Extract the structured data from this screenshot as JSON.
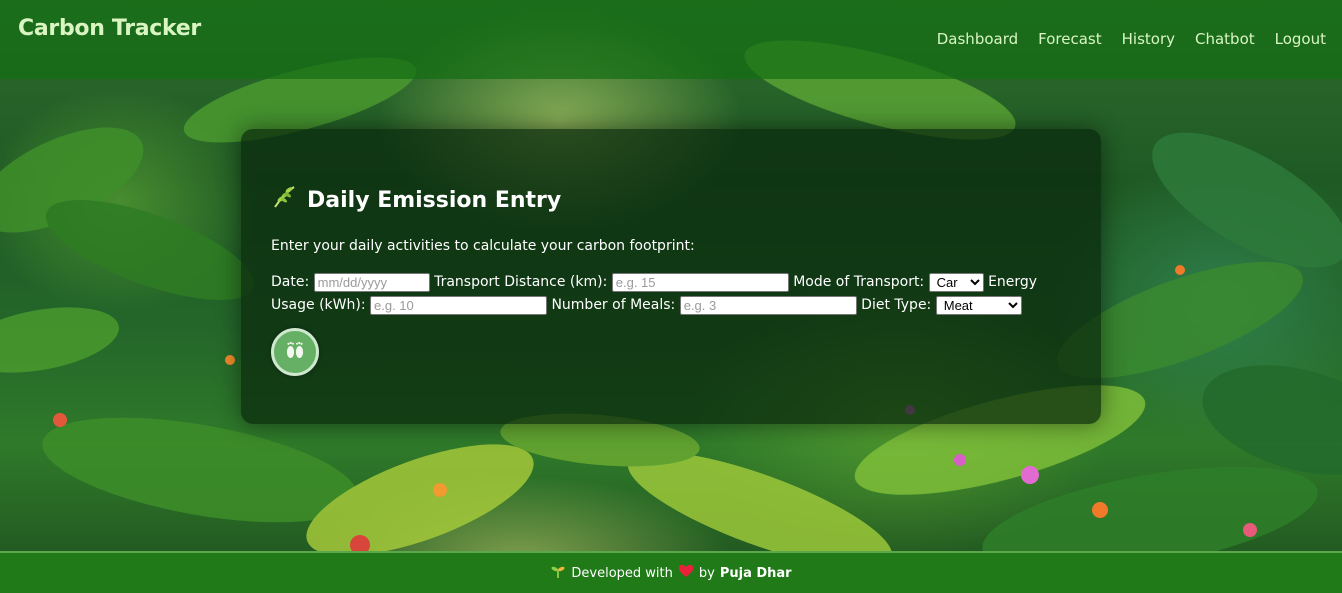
{
  "header": {
    "brand": "Carbon Tracker",
    "nav": [
      "Dashboard",
      "Forecast",
      "History",
      "Chatbot",
      "Logout"
    ]
  },
  "entry": {
    "title": "Daily Emission Entry",
    "title_icon": "leaf-icon",
    "subtitle": "Enter your daily activities to calculate your carbon footprint:",
    "fields": {
      "date_label": "Date:",
      "date_placeholder": "mm/dd/yyyy",
      "distance_label": "Transport Distance (km):",
      "distance_placeholder": "e.g. 15",
      "mode_label": "Mode of Transport:",
      "mode_value": "Car",
      "energy_label": "Energy Usage (kWh):",
      "energy_placeholder": "e.g. 10",
      "meals_label": "Number of Meals:",
      "meals_placeholder": "e.g. 3",
      "diet_label": "Diet Type:",
      "diet_value": "Meat"
    },
    "submit_icon": "footprints-icon"
  },
  "footer": {
    "prefix": "Developed with",
    "by": "by",
    "author": "Puja Dhar",
    "sprout_icon": "sprout-icon",
    "heart_icon": "heart-icon"
  },
  "colors": {
    "header_bg": "#146e14",
    "footer_bg": "#1f7a17",
    "brand_text": "#d9f5c2",
    "card_bg": "#0a280c",
    "button": "#66b066"
  }
}
